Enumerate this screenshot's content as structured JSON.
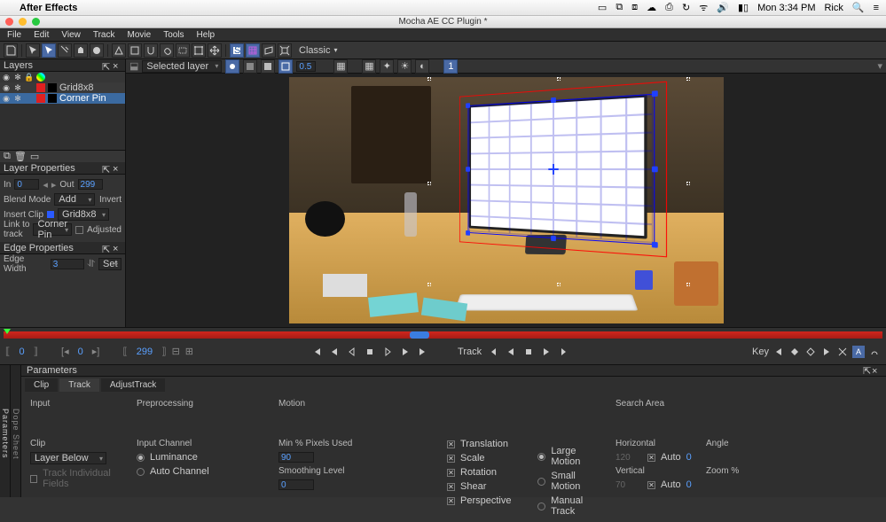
{
  "mac": {
    "app": "After Effects",
    "clock": "Mon 3:34 PM",
    "user": "Rick"
  },
  "window": {
    "title": "Mocha AE CC Plugin *"
  },
  "appmenu": [
    "File",
    "Edit",
    "View",
    "Track",
    "Movie",
    "Tools",
    "Help"
  ],
  "toolbar": {
    "workspace": "Classic"
  },
  "viewtools": {
    "selector_label": "Selected layer",
    "opacity": "0.5"
  },
  "layers": {
    "title": "Layers",
    "row1_name": "Grid8x8",
    "row2_name": "Corner Pin"
  },
  "layerprops": {
    "title": "Layer Properties",
    "in_label": "In",
    "in_val": "0",
    "out_label": "Out",
    "out_val": "299",
    "blend_label": "Blend Mode",
    "blend_val": "Add",
    "invert": "Invert",
    "insert_label": "Insert Clip",
    "insert_val": "Grid8x8",
    "link_label": "Link to track",
    "link_val": "Corner Pin",
    "adjusted": "Adjusted"
  },
  "edgeprops": {
    "title": "Edge Properties",
    "width_label": "Edge Width",
    "width_val": "3",
    "set": "Set"
  },
  "timeline": {
    "f_start": "0",
    "f_cur": "0",
    "f_end": "299",
    "track_label": "Track",
    "key_label": "Key"
  },
  "params": {
    "title": "Parameters",
    "tabs": {
      "clip": "Clip",
      "track": "Track",
      "adjust": "AdjustTrack"
    },
    "sidetab": "Parameters",
    "dopetab": "Dope Sheet",
    "input_hdr": "Input",
    "prep_hdr": "Preprocessing",
    "motion_hdr": "Motion",
    "search_hdr": "Search Area",
    "clip_label": "Clip",
    "clip_val": "Layer Below",
    "track_indiv": "Track Individual Fields",
    "channel_hdr": "Input Channel",
    "lum": "Luminance",
    "autoch": "Auto Channel",
    "minpix_hdr": "Min % Pixels Used",
    "minpix_val": "90",
    "smooth_hdr": "Smoothing Level",
    "smooth_val": "0",
    "m_trans": "Translation",
    "m_scale": "Scale",
    "m_rot": "Rotation",
    "m_shear": "Shear",
    "m_persp": "Perspective",
    "m_large": "Large Motion",
    "m_small": "Small Motion",
    "m_manual": "Manual Track",
    "s_horiz": "Horizontal",
    "s_vert": "Vertical",
    "s_h_val": "120",
    "s_v_val": "70",
    "s_auto": "Auto",
    "s_angle": "Angle",
    "s_angle_val": "0",
    "s_zoom": "Zoom %",
    "s_zoom_val": "0"
  }
}
